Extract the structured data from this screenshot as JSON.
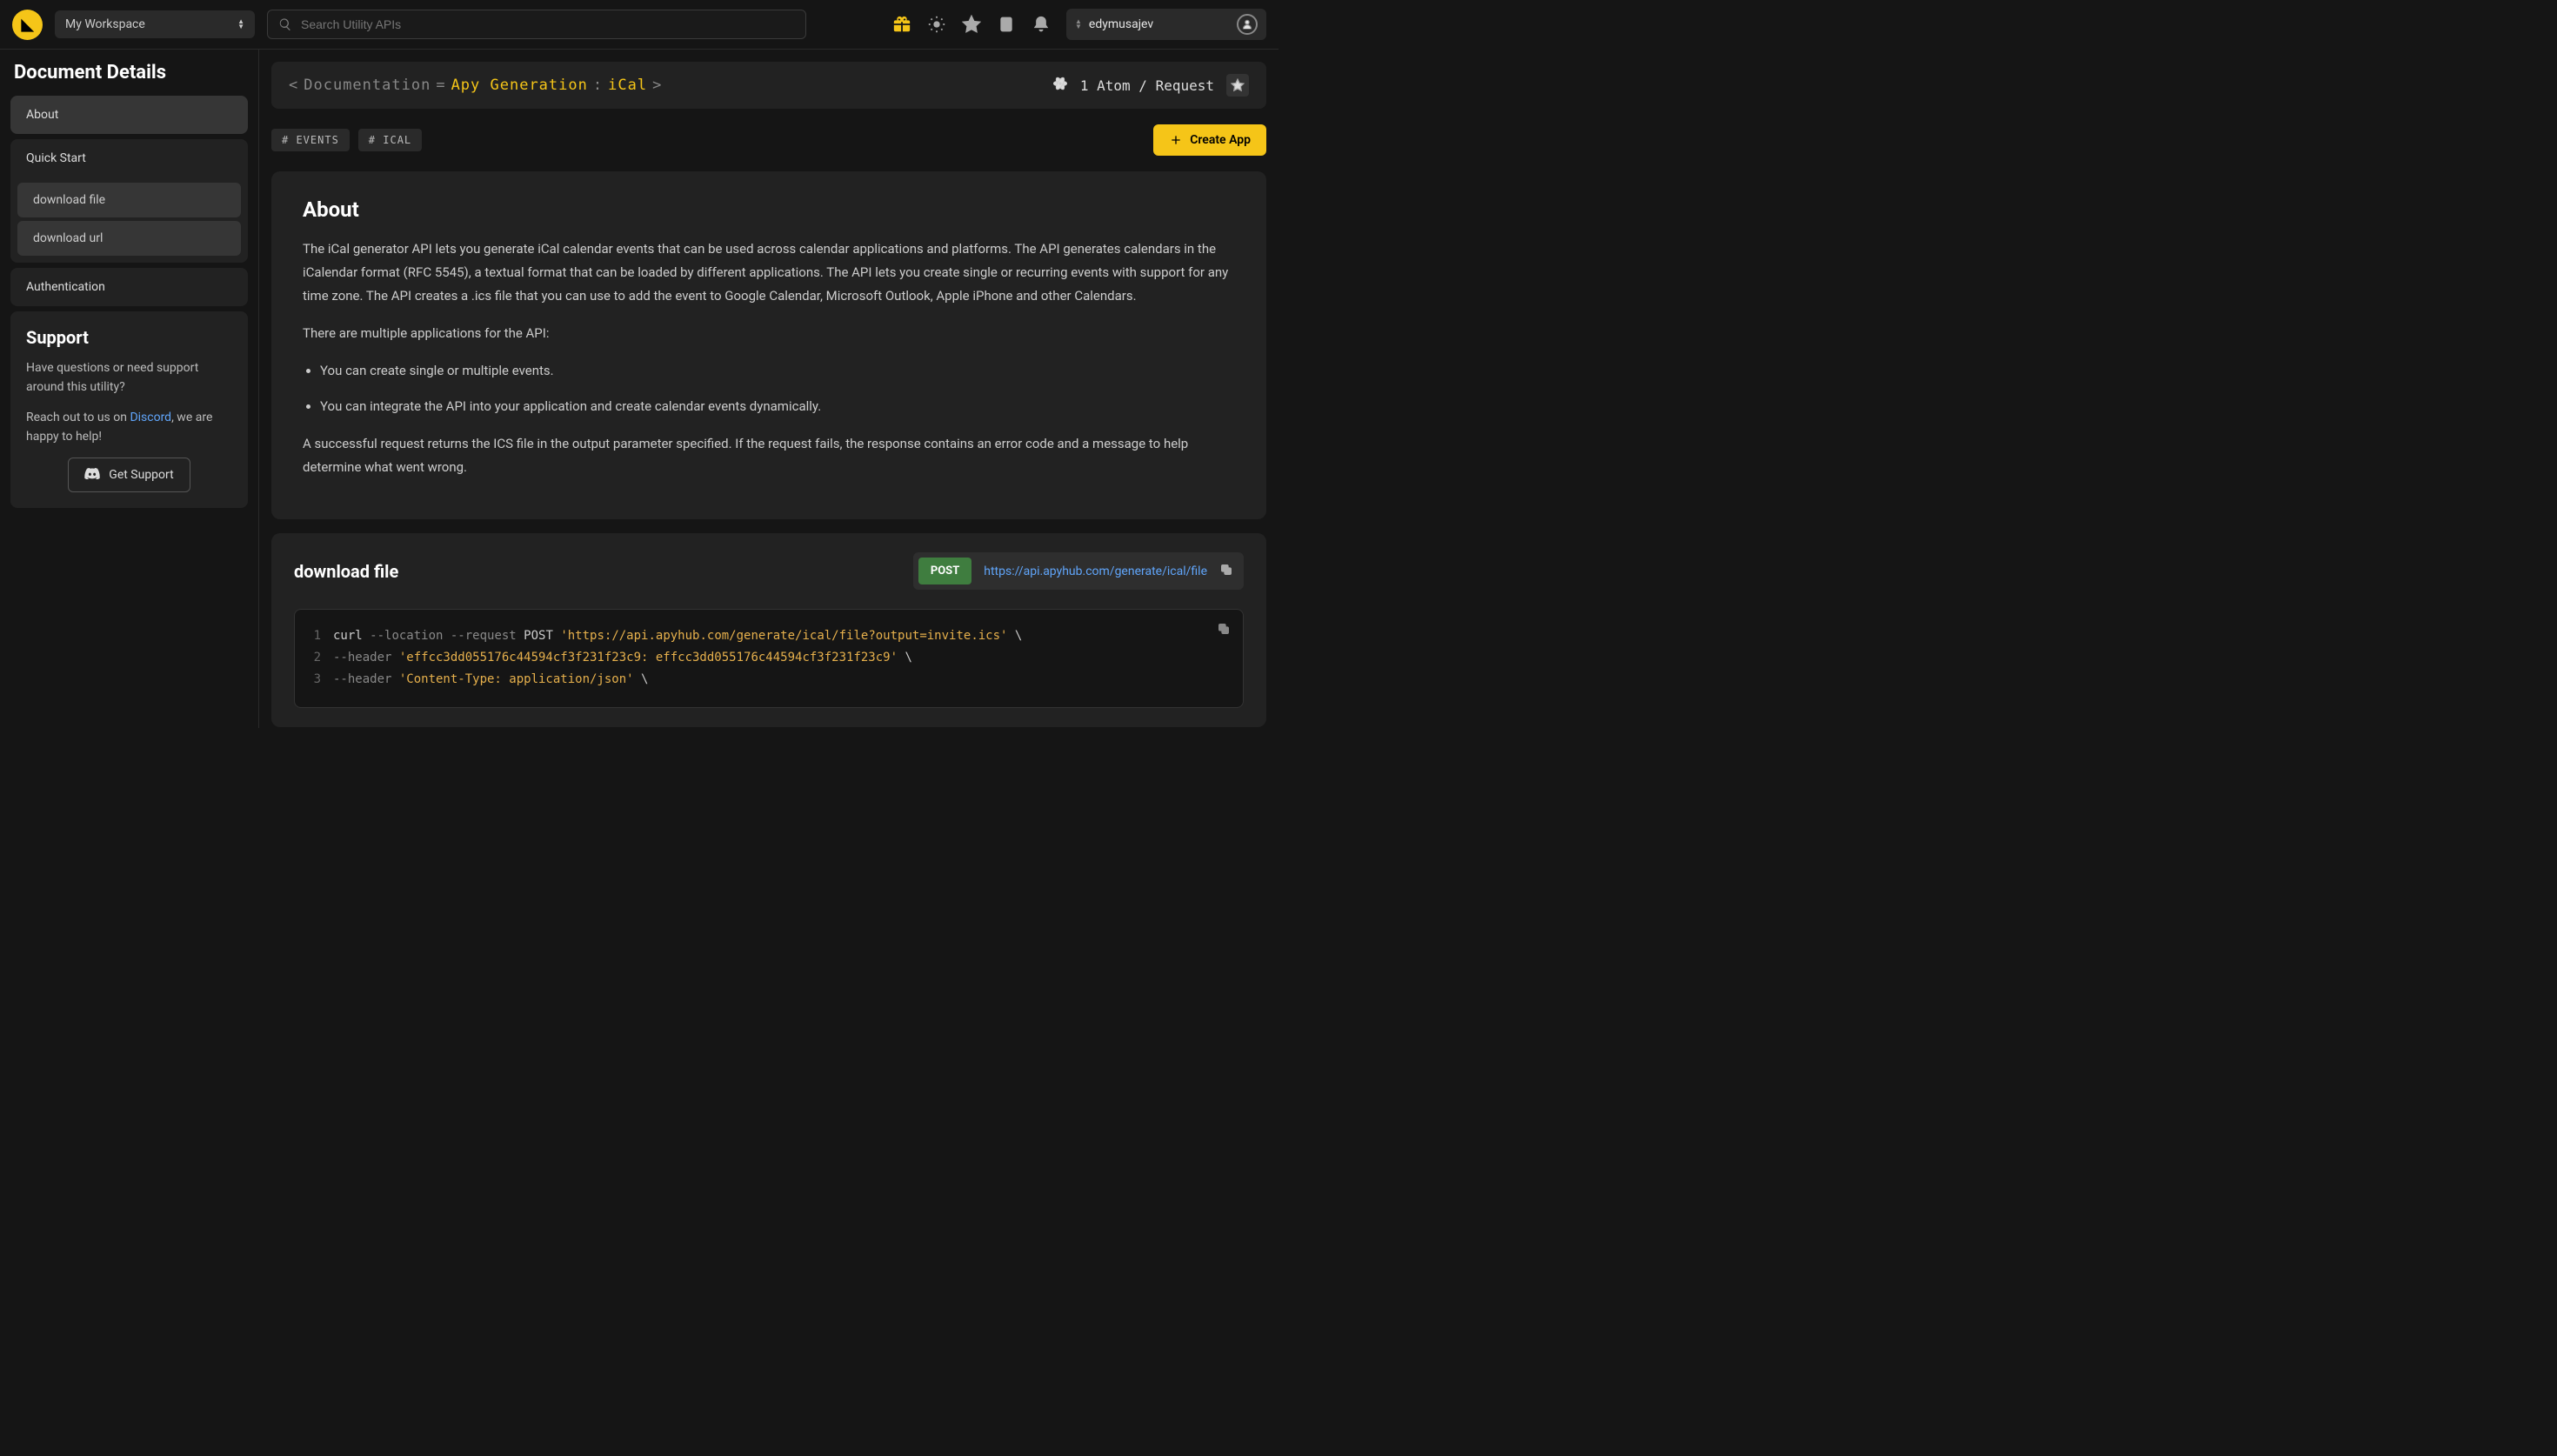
{
  "header": {
    "workspace": "My Workspace",
    "searchPlaceholder": "Search Utility APIs",
    "username": "edymusajev"
  },
  "sidebar": {
    "title": "Document Details",
    "nav": {
      "about": "About",
      "quickStart": "Quick Start",
      "sub": {
        "downloadFile": "download file",
        "downloadUrl": "download url"
      },
      "authentication": "Authentication"
    },
    "support": {
      "heading": "Support",
      "p1": "Have questions or need support around this utility?",
      "p2a": "Reach out to us on ",
      "p2link": "Discord",
      "p2b": ", we are happy to help!",
      "button": "Get Support"
    }
  },
  "breadcrumb": {
    "lt": "<",
    "doc": "Documentation",
    "eq": " = ",
    "gen": "Apy Generation",
    "colon": " : ",
    "name": "iCal",
    "gt": ">",
    "atoms": "1 Atom / Request"
  },
  "tags": {
    "events": "# EVENTS",
    "ical": "# ICAL"
  },
  "createApp": "Create App",
  "about": {
    "heading": "About",
    "p1": "The iCal generator API lets you generate iCal calendar events that can be used across calendar applications and platforms. The API generates calendars in the iCalendar format (RFC 5545), a textual format that can be loaded by different applications. The API lets you create single or recurring events with support for any time zone. The API creates a .ics file that you can use to add the event to Google Calendar, Microsoft Outlook, Apple iPhone and other Calendars.",
    "p2": "There are multiple applications for the API:",
    "li1": "You can create single or multiple events.",
    "li2": "You can integrate the API into your application and create calendar events dynamically.",
    "p3": "A successful request returns the ICS file in the output parameter specified. If the request fails, the response contains an error code and a message to help determine what went wrong."
  },
  "endpoint": {
    "title": "download file",
    "method": "POST",
    "url": "https://api.apyhub.com/generate/ical/file"
  },
  "code": {
    "l1a": "curl ",
    "l1b": "--location --request",
    "l1c": " POST ",
    "l1d": "'https://api.apyhub.com/generate/ical/file?output=invite.ics'",
    "l1e": " \\",
    "l2a": "--header ",
    "l2b": "'effcc3dd055176c44594cf3f231f23c9: effcc3dd055176c44594cf3f231f23c9'",
    "l2c": " \\",
    "l3a": "--header ",
    "l3b": "'Content-Type: application/json'",
    "l3c": " \\"
  }
}
